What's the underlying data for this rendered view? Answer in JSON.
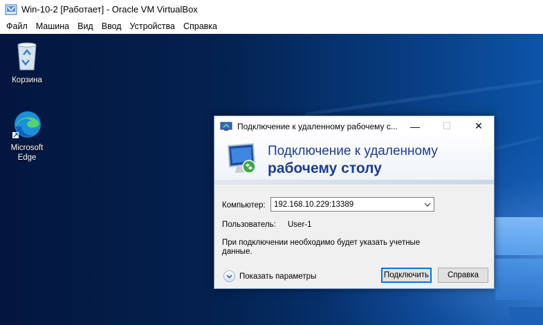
{
  "vbox": {
    "title": "Win-10-2 [Работает] - Oracle VM VirtualBox",
    "menu": [
      "Файл",
      "Машина",
      "Вид",
      "Ввод",
      "Устройства",
      "Справка"
    ]
  },
  "desktop": {
    "icons": [
      {
        "label": "Корзина",
        "icon": "recycle-bin-icon"
      },
      {
        "label": "Microsoft Edge",
        "icon": "edge-icon"
      }
    ]
  },
  "rdp": {
    "title": "Подключение к удаленному рабочему с...",
    "heading_line1": "Подключение к удаленному",
    "heading_line2": "рабочему столу",
    "computer_label": "Компьютер:",
    "computer_value": "192.168.10.229:13389",
    "user_label": "Пользователь:",
    "user_value": "User-1",
    "info_text": "При подключении необходимо будет указать учетные данные.",
    "options_label": "Показать параметры",
    "connect_label": "Подключить",
    "help_label": "Справка",
    "minimize_glyph": "—",
    "maximize_glyph": "☐",
    "close_glyph": "✕"
  },
  "colors": {
    "heading": "#1b3d8b",
    "focus_border": "#0078d7"
  }
}
